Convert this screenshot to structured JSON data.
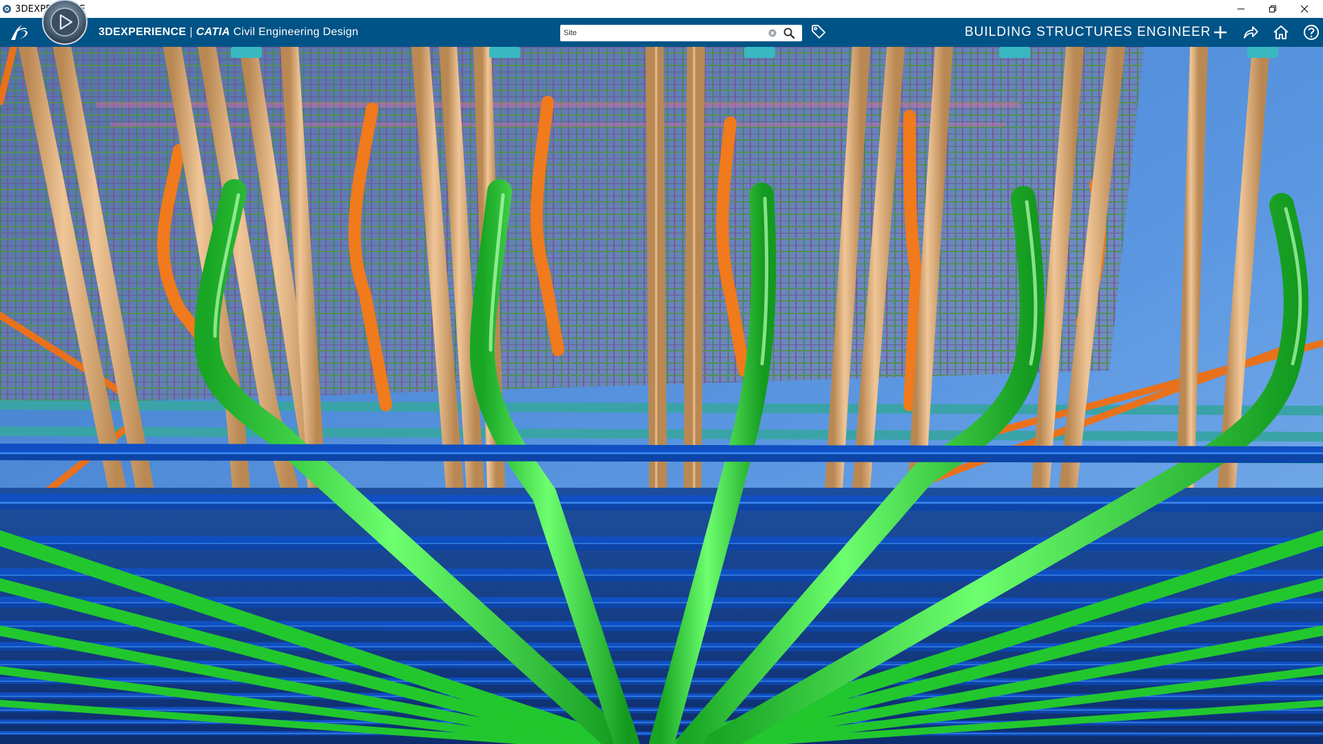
{
  "window": {
    "title": "3DEXPERIENCE",
    "controls": [
      "minimize-icon",
      "restore-icon",
      "close-icon"
    ]
  },
  "appbar": {
    "brand_prefix": "3DEXPERIENCE",
    "brand_separator": "|",
    "brand_app": "CATIA",
    "brand_suffix": "Civil Engineering Design",
    "search_value": "Site",
    "role": "BUILDING STRUCTURES ENGINEER",
    "icons": [
      "ds-logo-icon",
      "compass-icon",
      "search-clear-icon",
      "search-icon",
      "tag-icon",
      "add-icon",
      "share-icon",
      "home-icon",
      "help-icon"
    ],
    "background": "#005386"
  },
  "viewport": {
    "content": "3D rebar model",
    "colors": {
      "sky": "#4a86d8",
      "tan_bars": "#e3b07c",
      "orange_bars": "#f07a1c",
      "green_bars": "#2fe23c",
      "blue_bars": "#1f6ee6",
      "teal_bars": "#3aa0a6",
      "grid_green": "#2f8f4a",
      "grid_purple": "#6a5aa8"
    }
  }
}
